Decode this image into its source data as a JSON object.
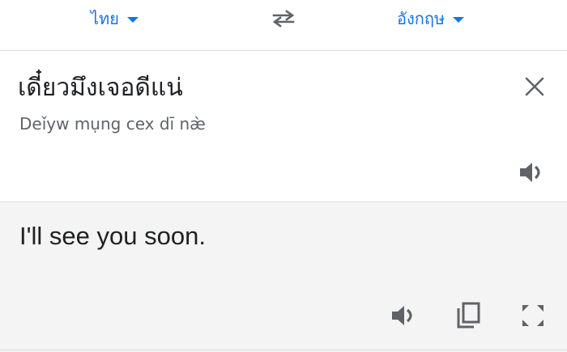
{
  "language_bar": {
    "source_language": "ไทย",
    "target_language": "อังกฤษ",
    "swap_icon": "swap-arrows-icon",
    "accent_color": "#1a73e8"
  },
  "source": {
    "text": "เดี๋ยวมึงเจอดีแน่",
    "transliteration": "Deǐyw mụng cex dī næ̀",
    "clear_icon": "close-icon",
    "speak_icon": "speaker-icon"
  },
  "result": {
    "text": "I'll see you soon.",
    "background": "#f4f4f4",
    "icons": [
      "speaker-icon",
      "copy-icon",
      "fullscreen-icon"
    ]
  }
}
